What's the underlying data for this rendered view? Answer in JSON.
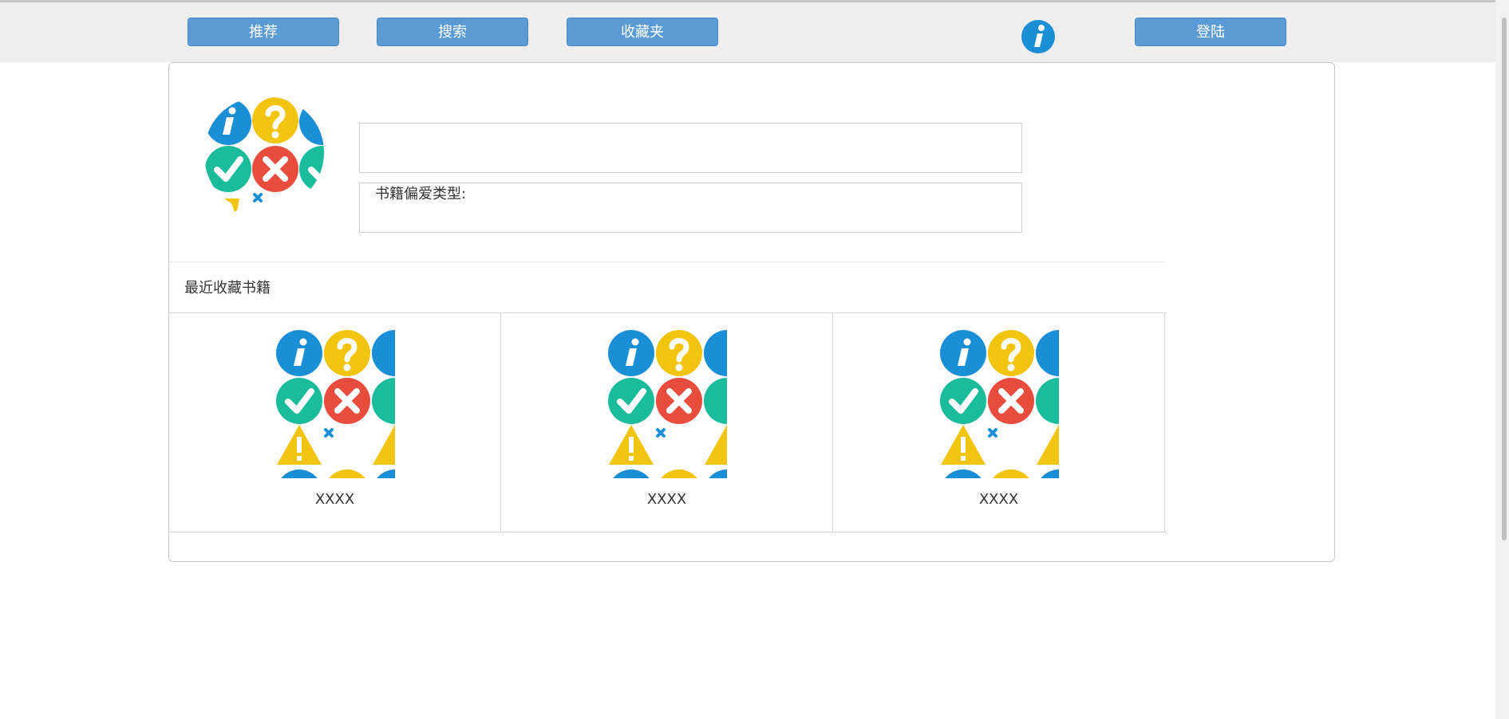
{
  "nav": {
    "recommend_label": "推荐",
    "search_label": "搜索",
    "favorites_label": "收藏夹",
    "login_label": "登陆"
  },
  "profile": {
    "name_value": "",
    "preference_label": "书籍偏爱类型:"
  },
  "recent": {
    "title": "最近收藏书籍",
    "books": [
      {
        "title": "XXXX"
      },
      {
        "title": "XXXX"
      },
      {
        "title": "XXXX"
      }
    ]
  },
  "colors": {
    "button": "#5b9bd5",
    "navbar_bg": "#eeeeee",
    "icon_blue": "#1a8fd6",
    "icon_yellow": "#f1c40f",
    "icon_green": "#1abc9c",
    "icon_red": "#e74c3c"
  }
}
